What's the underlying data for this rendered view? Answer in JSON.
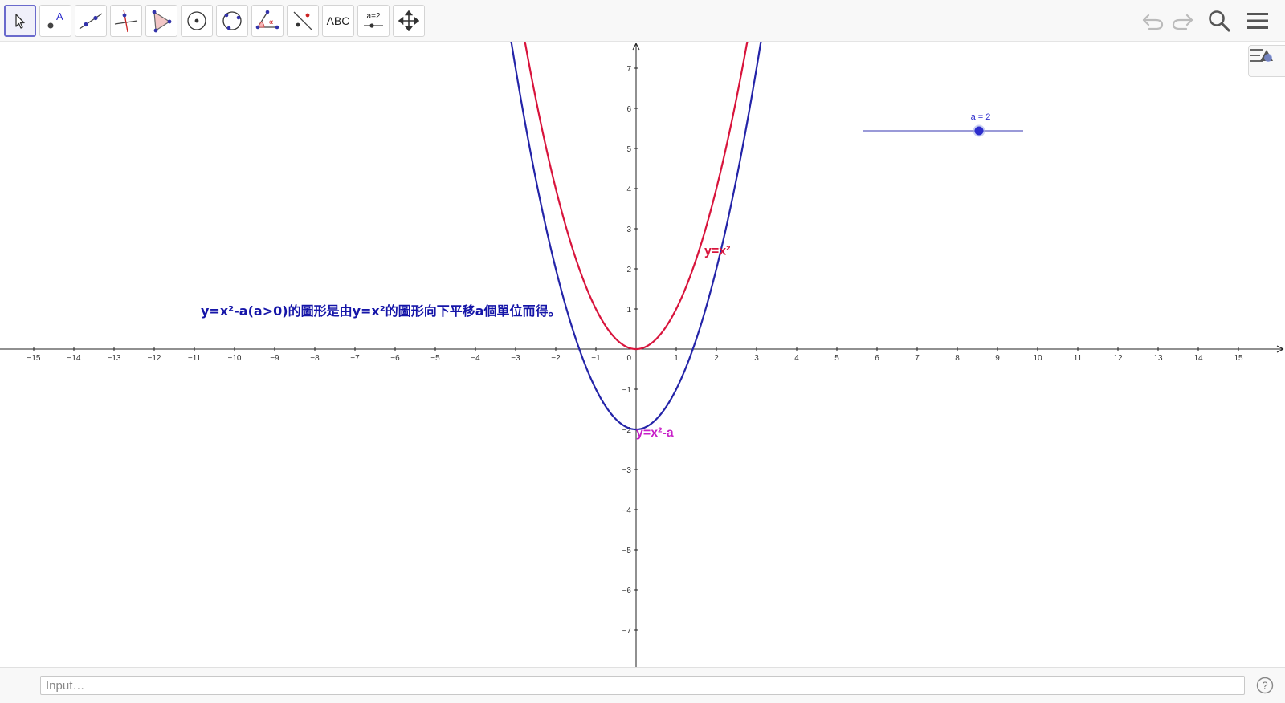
{
  "toolbar": {
    "tools": [
      {
        "name": "move-tool",
        "icon": "arrow-cursor-icon",
        "selected": true
      },
      {
        "name": "point-tool",
        "icon": "point-icon",
        "label": "A"
      },
      {
        "name": "line-tool",
        "icon": "line-through-points-icon"
      },
      {
        "name": "perpendicular-line-tool",
        "icon": "perpendicular-line-icon"
      },
      {
        "name": "polygon-tool",
        "icon": "polygon-icon"
      },
      {
        "name": "circle-center-point-tool",
        "icon": "circle-center-icon"
      },
      {
        "name": "circle-three-points-tool",
        "icon": "circle-three-points-icon"
      },
      {
        "name": "angle-tool",
        "icon": "angle-icon",
        "label": "α"
      },
      {
        "name": "reflect-tool",
        "icon": "reflect-about-line-icon"
      },
      {
        "name": "text-tool",
        "icon": "text-icon",
        "label": "ABC"
      },
      {
        "name": "slider-tool",
        "icon": "slider-icon",
        "label": "a=2"
      },
      {
        "name": "move-graphics-view-tool",
        "icon": "move-arrows-icon"
      }
    ],
    "right": [
      {
        "name": "undo-button",
        "icon": "undo-icon"
      },
      {
        "name": "redo-button",
        "icon": "redo-icon"
      },
      {
        "name": "search-button",
        "icon": "search-icon"
      },
      {
        "name": "menu-button",
        "icon": "hamburger-menu-icon"
      }
    ]
  },
  "graphics": {
    "x_ticks": [
      -15,
      -14,
      -13,
      -12,
      -11,
      -10,
      -9,
      -8,
      -7,
      -6,
      -5,
      -4,
      -3,
      -2,
      -1,
      1,
      2,
      3,
      4,
      5,
      6,
      7,
      8,
      9,
      10,
      11,
      12,
      13,
      14,
      15
    ],
    "y_ticks": [
      -7,
      -6,
      -5,
      -4,
      -3,
      -2,
      -1,
      1,
      2,
      3,
      4,
      5,
      6,
      7
    ],
    "origin_label": "0",
    "curves": [
      {
        "label": "y=x²",
        "expression": "x^2",
        "color": "#d8143c",
        "label_color": "#d8143c"
      },
      {
        "label": "y=x²-a",
        "expression": "x^2-a",
        "color": "#2424a8",
        "label_color": "#c81fc8"
      }
    ],
    "slider": {
      "label": "a = 2",
      "value": 2,
      "min": -5,
      "max": 5,
      "color": "#2d2dcc"
    },
    "description": "y=x²-a(a>0)的圖形是由y=x²的圖形向下平移a個單位而得。",
    "description_color": "#1515a8"
  },
  "inputbar": {
    "placeholder": "Input…"
  }
}
